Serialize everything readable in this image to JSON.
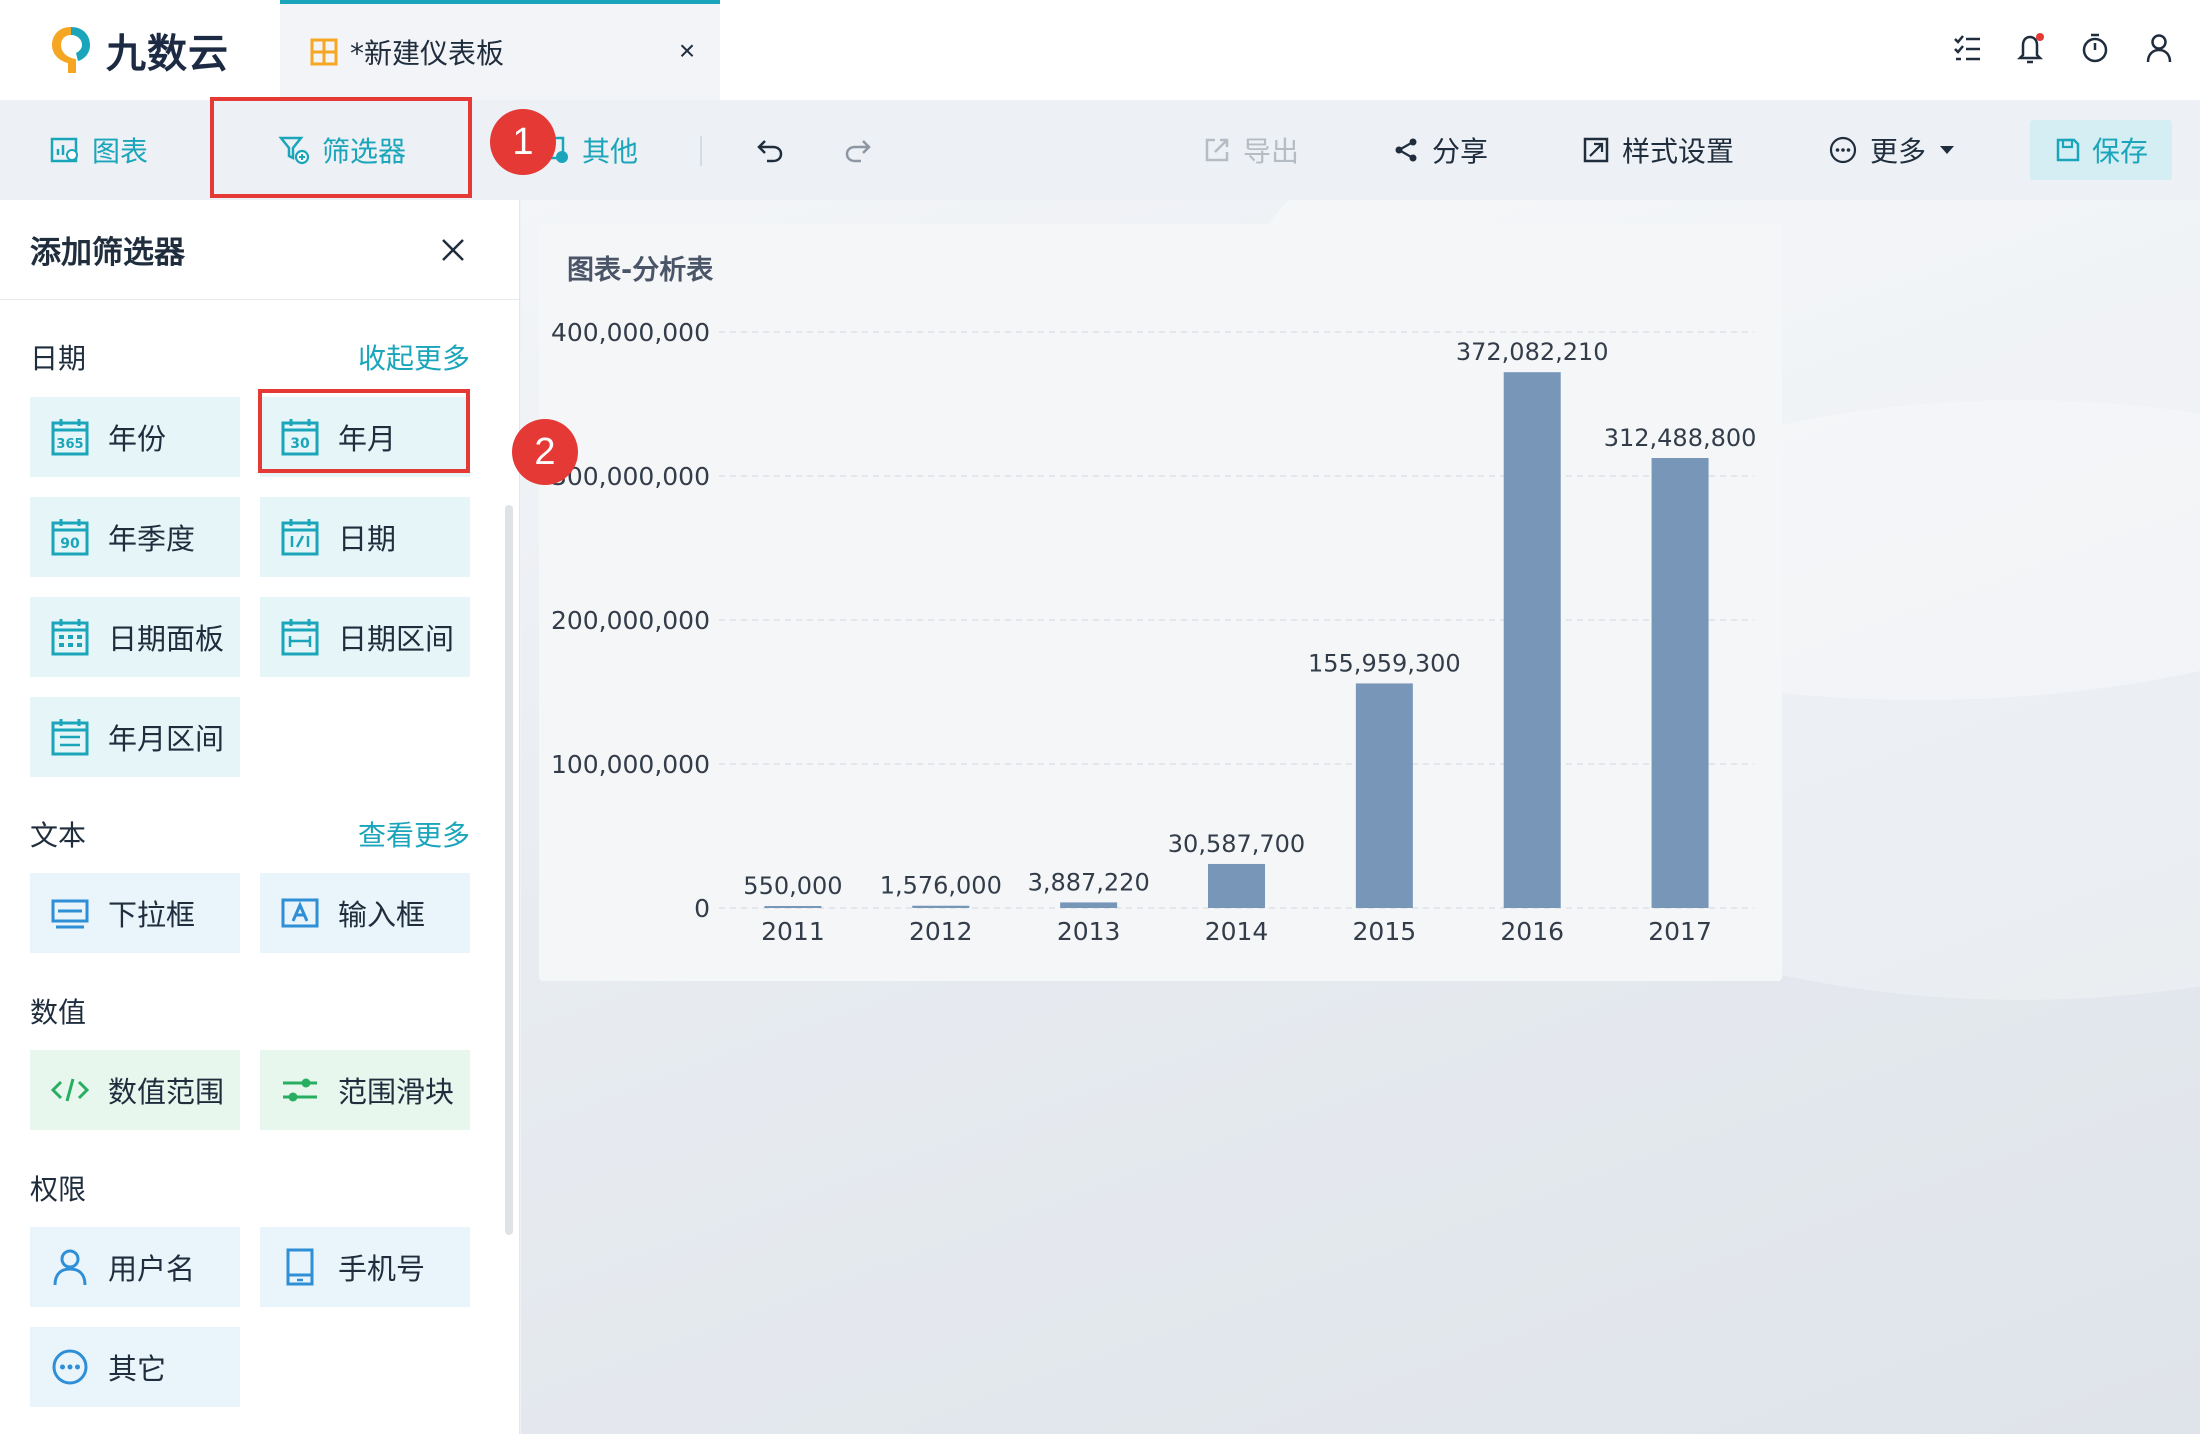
{
  "app": {
    "logo_text": "九数云"
  },
  "tab": {
    "label": "*新建仪表板",
    "close": "×"
  },
  "top_icons": [
    "list-check-icon",
    "bell-icon",
    "timer-icon",
    "user-icon"
  ],
  "toolbar": {
    "chart": "图表",
    "filter": "筛选器",
    "other": "其他",
    "undo": "undo-icon",
    "redo": "redo-icon",
    "export": "导出",
    "share": "分享",
    "style": "样式设置",
    "more": "更多",
    "save": "保存"
  },
  "panel": {
    "title": "添加筛选器",
    "sections": {
      "date": {
        "title": "日期",
        "link": "收起更多",
        "items": [
          "年份",
          "年月",
          "年季度",
          "日期",
          "日期面板",
          "日期区间",
          "年月区间"
        ]
      },
      "text": {
        "title": "文本",
        "link": "查看更多",
        "items": [
          "下拉框",
          "输入框"
        ]
      },
      "number": {
        "title": "数值",
        "items": [
          "数值范围",
          "范围滑块"
        ]
      },
      "permission": {
        "title": "权限",
        "items": [
          "用户名",
          "手机号",
          "其它"
        ]
      }
    }
  },
  "annotations": {
    "badge1": "1",
    "badge2": "2"
  },
  "colors": {
    "accent": "#1ba5ba",
    "bar": "#7896b8",
    "highlight": "#e53935"
  },
  "chart_data": {
    "type": "bar",
    "title": "图表-分析表",
    "categories": [
      "2011",
      "2012",
      "2013",
      "2014",
      "2015",
      "2016",
      "2017"
    ],
    "values": [
      550000,
      1576000,
      3887220,
      30587700,
      155959300,
      372082210,
      312488800
    ],
    "value_labels": [
      "550,000",
      "1,576,000",
      "3,887,220",
      "30,587,700",
      "155,959,300",
      "372,082,210",
      "312,488,800"
    ],
    "y_ticks": [
      0,
      100000000,
      200000000,
      300000000,
      400000000
    ],
    "y_tick_labels": [
      "0",
      "100,000,000",
      "200,000,000",
      "300,000,000",
      "400,000,000"
    ],
    "ylim": [
      0,
      400000000
    ],
    "grid": true
  }
}
